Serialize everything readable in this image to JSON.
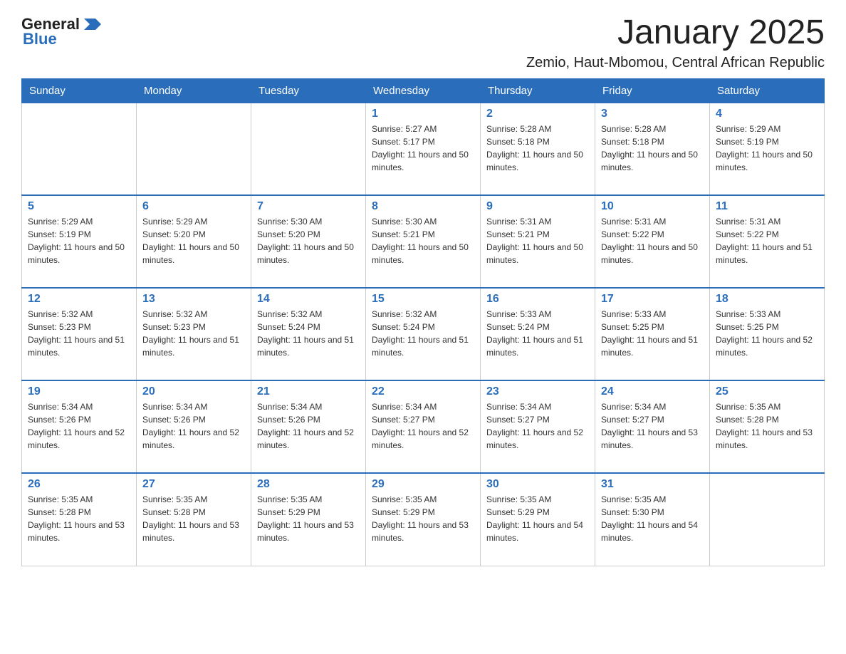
{
  "logo": {
    "text_general": "General",
    "text_blue": "Blue",
    "arrow_color": "#2a6ebb"
  },
  "header": {
    "month_title": "January 2025",
    "location": "Zemio, Haut-Mbomou, Central African Republic"
  },
  "weekdays": [
    "Sunday",
    "Monday",
    "Tuesday",
    "Wednesday",
    "Thursday",
    "Friday",
    "Saturday"
  ],
  "weeks": [
    [
      {
        "day": "",
        "sunrise": "",
        "sunset": "",
        "daylight": ""
      },
      {
        "day": "",
        "sunrise": "",
        "sunset": "",
        "daylight": ""
      },
      {
        "day": "",
        "sunrise": "",
        "sunset": "",
        "daylight": ""
      },
      {
        "day": "1",
        "sunrise": "5:27 AM",
        "sunset": "5:17 PM",
        "daylight": "11 hours and 50 minutes."
      },
      {
        "day": "2",
        "sunrise": "5:28 AM",
        "sunset": "5:18 PM",
        "daylight": "11 hours and 50 minutes."
      },
      {
        "day": "3",
        "sunrise": "5:28 AM",
        "sunset": "5:18 PM",
        "daylight": "11 hours and 50 minutes."
      },
      {
        "day": "4",
        "sunrise": "5:29 AM",
        "sunset": "5:19 PM",
        "daylight": "11 hours and 50 minutes."
      }
    ],
    [
      {
        "day": "5",
        "sunrise": "5:29 AM",
        "sunset": "5:19 PM",
        "daylight": "11 hours and 50 minutes."
      },
      {
        "day": "6",
        "sunrise": "5:29 AM",
        "sunset": "5:20 PM",
        "daylight": "11 hours and 50 minutes."
      },
      {
        "day": "7",
        "sunrise": "5:30 AM",
        "sunset": "5:20 PM",
        "daylight": "11 hours and 50 minutes."
      },
      {
        "day": "8",
        "sunrise": "5:30 AM",
        "sunset": "5:21 PM",
        "daylight": "11 hours and 50 minutes."
      },
      {
        "day": "9",
        "sunrise": "5:31 AM",
        "sunset": "5:21 PM",
        "daylight": "11 hours and 50 minutes."
      },
      {
        "day": "10",
        "sunrise": "5:31 AM",
        "sunset": "5:22 PM",
        "daylight": "11 hours and 50 minutes."
      },
      {
        "day": "11",
        "sunrise": "5:31 AM",
        "sunset": "5:22 PM",
        "daylight": "11 hours and 51 minutes."
      }
    ],
    [
      {
        "day": "12",
        "sunrise": "5:32 AM",
        "sunset": "5:23 PM",
        "daylight": "11 hours and 51 minutes."
      },
      {
        "day": "13",
        "sunrise": "5:32 AM",
        "sunset": "5:23 PM",
        "daylight": "11 hours and 51 minutes."
      },
      {
        "day": "14",
        "sunrise": "5:32 AM",
        "sunset": "5:24 PM",
        "daylight": "11 hours and 51 minutes."
      },
      {
        "day": "15",
        "sunrise": "5:32 AM",
        "sunset": "5:24 PM",
        "daylight": "11 hours and 51 minutes."
      },
      {
        "day": "16",
        "sunrise": "5:33 AM",
        "sunset": "5:24 PM",
        "daylight": "11 hours and 51 minutes."
      },
      {
        "day": "17",
        "sunrise": "5:33 AM",
        "sunset": "5:25 PM",
        "daylight": "11 hours and 51 minutes."
      },
      {
        "day": "18",
        "sunrise": "5:33 AM",
        "sunset": "5:25 PM",
        "daylight": "11 hours and 52 minutes."
      }
    ],
    [
      {
        "day": "19",
        "sunrise": "5:34 AM",
        "sunset": "5:26 PM",
        "daylight": "11 hours and 52 minutes."
      },
      {
        "day": "20",
        "sunrise": "5:34 AM",
        "sunset": "5:26 PM",
        "daylight": "11 hours and 52 minutes."
      },
      {
        "day": "21",
        "sunrise": "5:34 AM",
        "sunset": "5:26 PM",
        "daylight": "11 hours and 52 minutes."
      },
      {
        "day": "22",
        "sunrise": "5:34 AM",
        "sunset": "5:27 PM",
        "daylight": "11 hours and 52 minutes."
      },
      {
        "day": "23",
        "sunrise": "5:34 AM",
        "sunset": "5:27 PM",
        "daylight": "11 hours and 52 minutes."
      },
      {
        "day": "24",
        "sunrise": "5:34 AM",
        "sunset": "5:27 PM",
        "daylight": "11 hours and 53 minutes."
      },
      {
        "day": "25",
        "sunrise": "5:35 AM",
        "sunset": "5:28 PM",
        "daylight": "11 hours and 53 minutes."
      }
    ],
    [
      {
        "day": "26",
        "sunrise": "5:35 AM",
        "sunset": "5:28 PM",
        "daylight": "11 hours and 53 minutes."
      },
      {
        "day": "27",
        "sunrise": "5:35 AM",
        "sunset": "5:28 PM",
        "daylight": "11 hours and 53 minutes."
      },
      {
        "day": "28",
        "sunrise": "5:35 AM",
        "sunset": "5:29 PM",
        "daylight": "11 hours and 53 minutes."
      },
      {
        "day": "29",
        "sunrise": "5:35 AM",
        "sunset": "5:29 PM",
        "daylight": "11 hours and 53 minutes."
      },
      {
        "day": "30",
        "sunrise": "5:35 AM",
        "sunset": "5:29 PM",
        "daylight": "11 hours and 54 minutes."
      },
      {
        "day": "31",
        "sunrise": "5:35 AM",
        "sunset": "5:30 PM",
        "daylight": "11 hours and 54 minutes."
      },
      {
        "day": "",
        "sunrise": "",
        "sunset": "",
        "daylight": ""
      }
    ]
  ],
  "labels": {
    "sunrise": "Sunrise:",
    "sunset": "Sunset:",
    "daylight": "Daylight:"
  }
}
